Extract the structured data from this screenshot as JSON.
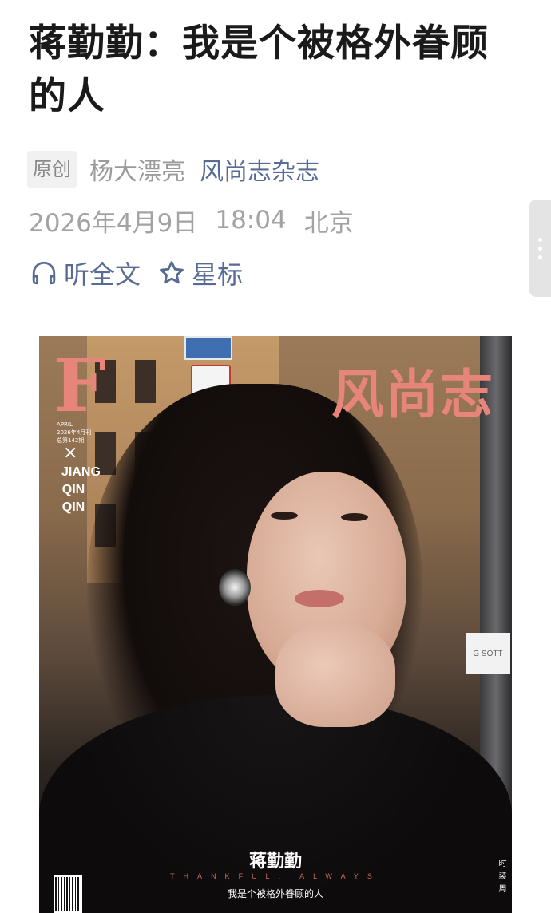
{
  "article": {
    "title": "蒋勤勤：我是个被格外眷顾的人",
    "original_tag": "原创",
    "author": "杨大漂亮",
    "account": "风尚志杂志",
    "date": "2026年4月9日",
    "time": "18:04",
    "location": "北京"
  },
  "actions": {
    "listen": {
      "label": "听全文",
      "icon": "headphones-icon"
    },
    "star": {
      "label": "星标",
      "icon": "star-icon"
    }
  },
  "cover": {
    "logo": "F",
    "issue_month": "APRIL",
    "issue_line1": "2026年4月刊",
    "issue_line2": "总第142期",
    "cross": "×",
    "vertical_name": [
      "JIANG",
      "QIN",
      "QIN"
    ],
    "masthead": "风尚志",
    "name": "蒋勤勤",
    "tagline": "THANKFUL, ALWAYS",
    "subtitle": "我是个被格外眷顾的人",
    "spine": "时装周",
    "sticker": "G SOTT"
  },
  "colors": {
    "link": "#576b95",
    "muted": "#a3a3a3",
    "masthead": "#e7857a"
  }
}
